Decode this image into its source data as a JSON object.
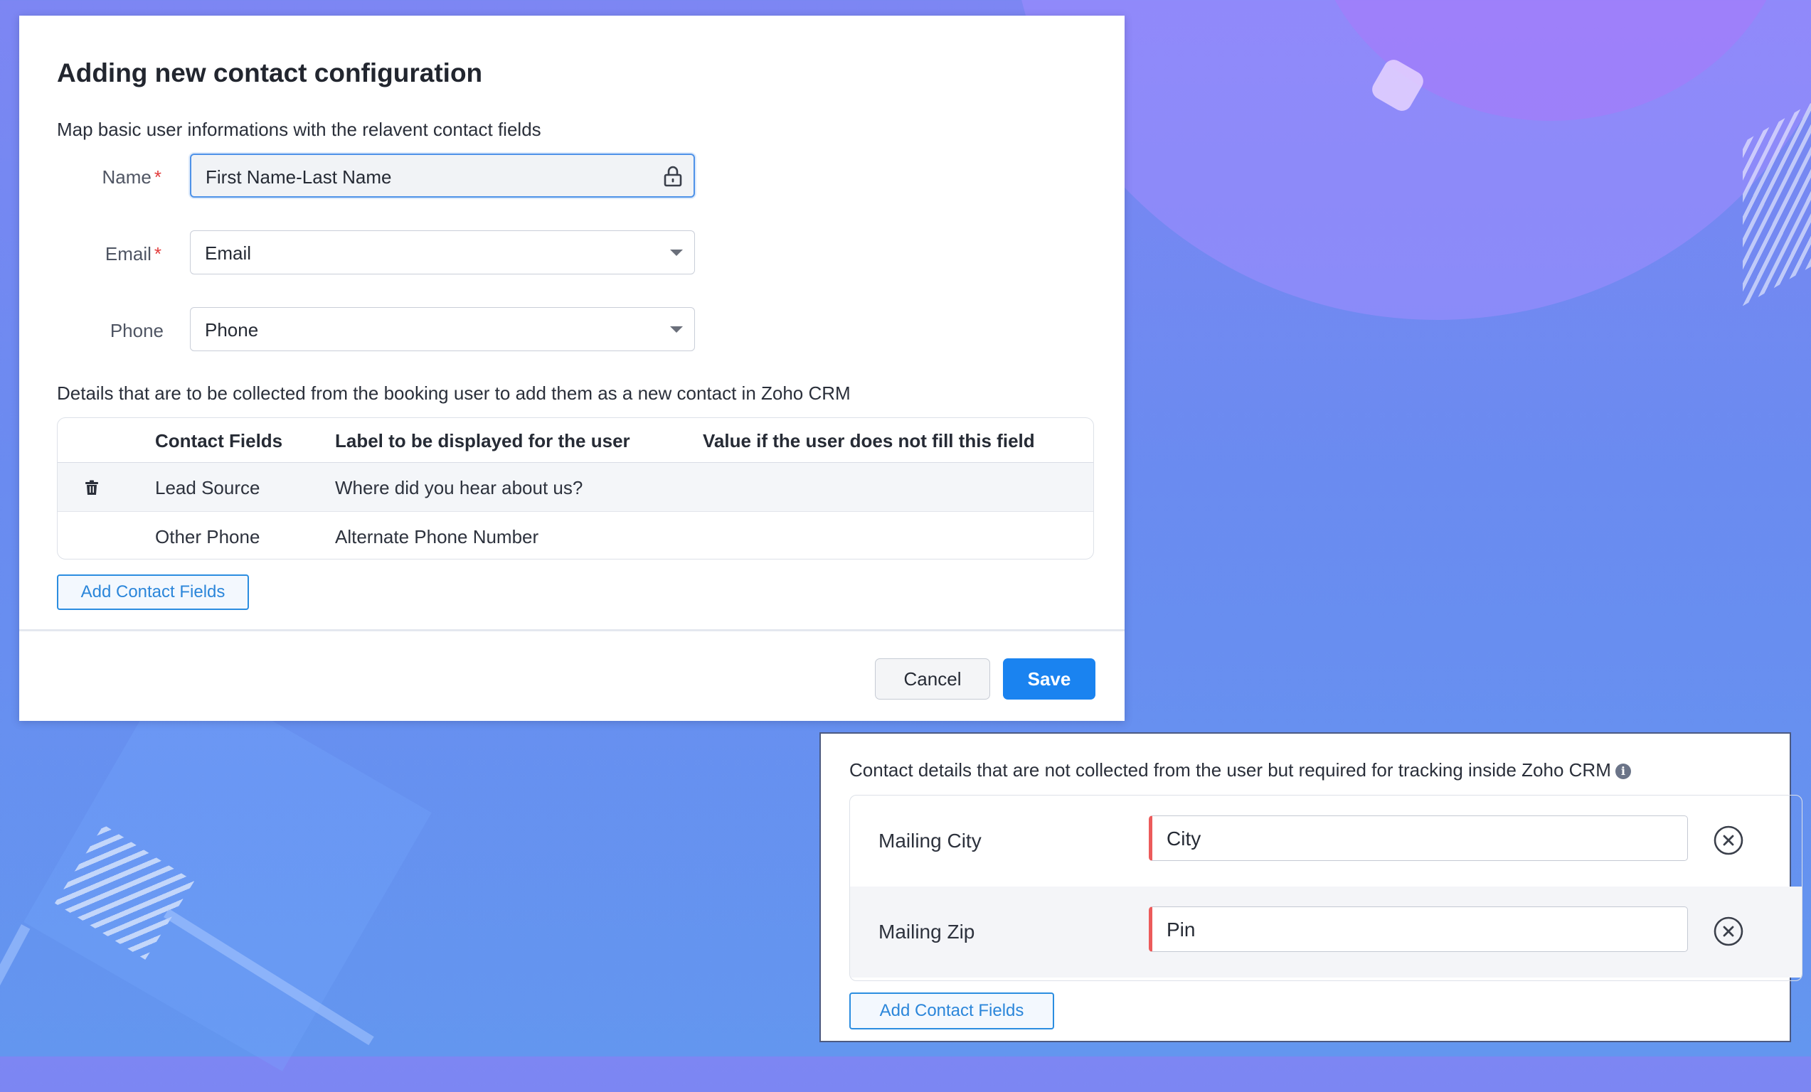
{
  "dialog": {
    "title": "Adding new contact configuration",
    "mapping_description": "Map basic user informations with the relavent contact fields",
    "fields": [
      {
        "label": "Name",
        "required": "*",
        "value": "First Name-Last Name",
        "icon": "lock-icon"
      },
      {
        "label": "Email",
        "required": "*",
        "value": "Email",
        "icon": "chevron-down-icon"
      },
      {
        "label": "Phone",
        "required": "",
        "value": "Phone",
        "icon": "chevron-down-icon"
      }
    ],
    "collect_description": "Details that are to be collected from the booking user to add them as a new contact in Zoho CRM",
    "table": {
      "headers": [
        "Contact Fields",
        "Label to be displayed for the user",
        "Value if the user does not fill this field"
      ],
      "rows": [
        {
          "field": "Lead Source",
          "label": "Where did you hear about us?",
          "default": ""
        },
        {
          "field": "Other Phone",
          "label": "Alternate Phone Number",
          "default": ""
        }
      ]
    },
    "add_button": "Add Contact Fields",
    "cancel_button": "Cancel",
    "save_button": "Save"
  },
  "tracking_panel": {
    "description": "Contact details that are not collected from the user but required for tracking inside Zoho CRM",
    "info_icon": "i",
    "rows": [
      {
        "label": "Mailing City",
        "value": "City"
      },
      {
        "label": "Mailing Zip",
        "value": "Pin"
      }
    ],
    "add_button": "Add Contact Fields"
  },
  "colors": {
    "primary": "#1a83f0",
    "required": "#e23c3c",
    "focus_border": "#4e92e8",
    "error_marker": "#ec5b5b"
  }
}
